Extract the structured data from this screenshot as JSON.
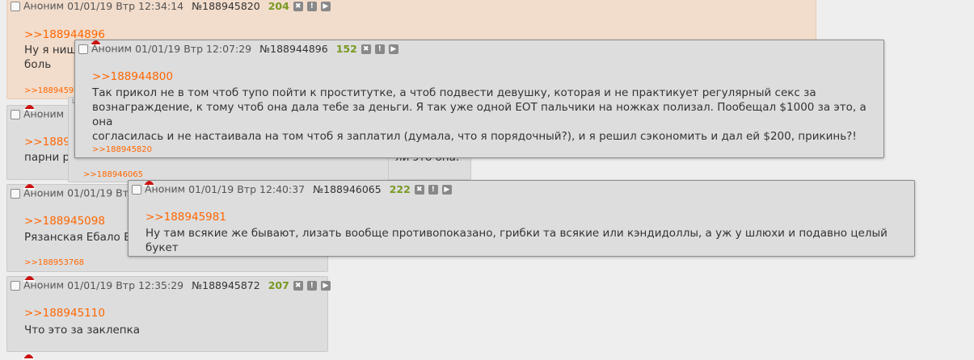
{
  "posts": {
    "p1": {
      "name": "Аноним",
      "date": "01/01/19 Втр 12:34:14",
      "num": "№188945820",
      "count": "204",
      "reply": ">>188944896",
      "line1": "Ну я нищ",
      "line2": "боль",
      "backref": ">>1889459"
    },
    "p2": {
      "name": "Аноним (",
      "reply": ">>18894",
      "line1": "парни р",
      "line1b": "ли это она.",
      "backref": ">>188946065"
    },
    "p3": {
      "name": "Аноним 01/01/19 Втр",
      "reply": ">>188945098",
      "line1": "Рязанская Ебало В",
      "backref": ">>188953768"
    },
    "p4": {
      "name": "Аноним",
      "date": "01/01/19 Втр 12:35:29",
      "num": "№188945872",
      "count": "207",
      "reply": ">>188945110",
      "line1": "Что это за заклепка"
    }
  },
  "popup1": {
    "name": "Аноним",
    "date": "01/01/19 Втр 12:07:29",
    "num": "№188944896",
    "count": "152",
    "reply": ">>188944800",
    "line1": "Так прикол не в том чтоб тупо пойти к проститутке, а чтоб подвести девушку, которая и не практикует регулярный секс за",
    "line2": "вознаграждение, к тому чтоб она дала тебе за деньги. Я так уже одной ЕОТ пальчики на ножках полизал. Пообещал $1000 за это, а она",
    "line3": "согласилась и не настаивала на том чтоб я заплатил (думала, что я порядочный?), и я решил сэкономить и дал ей $200, прикинь?!",
    "backref": ">>188945820"
  },
  "popup2": {
    "name": "Аноним",
    "date": "01/01/19 Втр 12:40:37",
    "num": "№188946065",
    "count": "222",
    "reply": ">>188945981",
    "line1": "Ну там всякие же бывают, лизать вообще противопоказано, грибки та всякие или кэндидоллы, а уж у шлюхи и подавно целый букет"
  },
  "icons": {
    "hide": "✖",
    "report": "!",
    "play": "▶"
  },
  "colors": {
    "quote": "#ff6600",
    "count": "#789922",
    "highlight_bg": "#f2dccb",
    "post_bg": "#dddddd"
  }
}
